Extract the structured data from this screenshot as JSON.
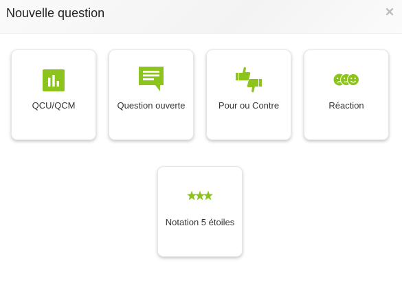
{
  "dialog": {
    "title": "Nouvelle question",
    "close_icon": "close-icon"
  },
  "accent_color": "#8cc31c",
  "options": [
    {
      "label": "QCU/QCM",
      "icon": "bar-chart-icon"
    },
    {
      "label": "Question ouverte",
      "icon": "speech-bubble-icon"
    },
    {
      "label": "Pour ou Contre",
      "icon": "thumbs-up-down-icon"
    },
    {
      "label": "Réaction",
      "icon": "emoji-faces-icon"
    },
    {
      "label": "Notation 5 étoiles",
      "icon": "three-stars-icon"
    }
  ]
}
